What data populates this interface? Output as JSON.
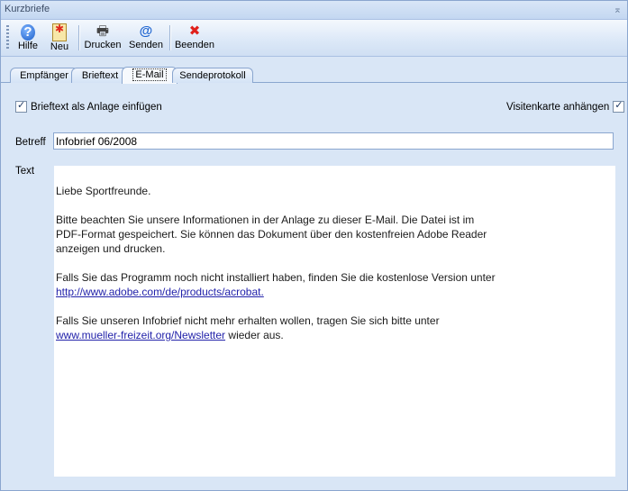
{
  "window": {
    "title": "Kurzbriefe",
    "pin_glyph": "⌅"
  },
  "toolbar": {
    "help": {
      "label": "Hilfe",
      "icon": "help-icon"
    },
    "new": {
      "label": "Neu",
      "icon": "new-document-icon"
    },
    "print": {
      "label": "Drucken",
      "icon": "printer-icon"
    },
    "send": {
      "label": "Senden",
      "icon": "at-sign-icon"
    },
    "exit": {
      "label": "Beenden",
      "icon": "close-x-icon"
    }
  },
  "tabs": [
    {
      "label": "Empfänger"
    },
    {
      "label": "Brieftext"
    },
    {
      "label": "E-Mail",
      "active": true
    },
    {
      "label": "Sendeprotokoll"
    }
  ],
  "options": {
    "attach_letter": {
      "label": "Brieftext als Anlage einfügen",
      "checked": true
    },
    "attach_vcard": {
      "label": "Visitenkarte anhängen",
      "checked": true
    }
  },
  "form": {
    "subject_label": "Betreff",
    "subject_value": "Infobrief 06/2008",
    "text_label": "Text",
    "body": {
      "greeting": "Liebe Sportfreunde.",
      "para1_line1": "Bitte beachten Sie unsere Informationen in der Anlage zu dieser E-Mail. Die Datei ist im",
      "para1_line2": "PDF-Format gespeichert. Sie können das Dokument über den kostenfreien Adobe Reader",
      "para1_line3": "anzeigen und drucken.",
      "para2_line1": "Falls Sie das Programm noch nicht installiert haben, finden Sie die kostenlose Version unter",
      "para2_link": "http://www.adobe.com/de/products/acrobat.",
      "para3_line1": "Falls Sie unseren Infobrief nicht mehr erhalten wollen, tragen Sie sich bitte unter",
      "para3_link": "www.mueller-freizeit.org/Newsletter",
      "para3_tail": " wieder aus."
    }
  },
  "colors": {
    "accent": "#1c63d0",
    "link": "#2222aa",
    "frame": "#d9e6f6",
    "border": "#8aa6cf",
    "exit": "#e0201b"
  }
}
